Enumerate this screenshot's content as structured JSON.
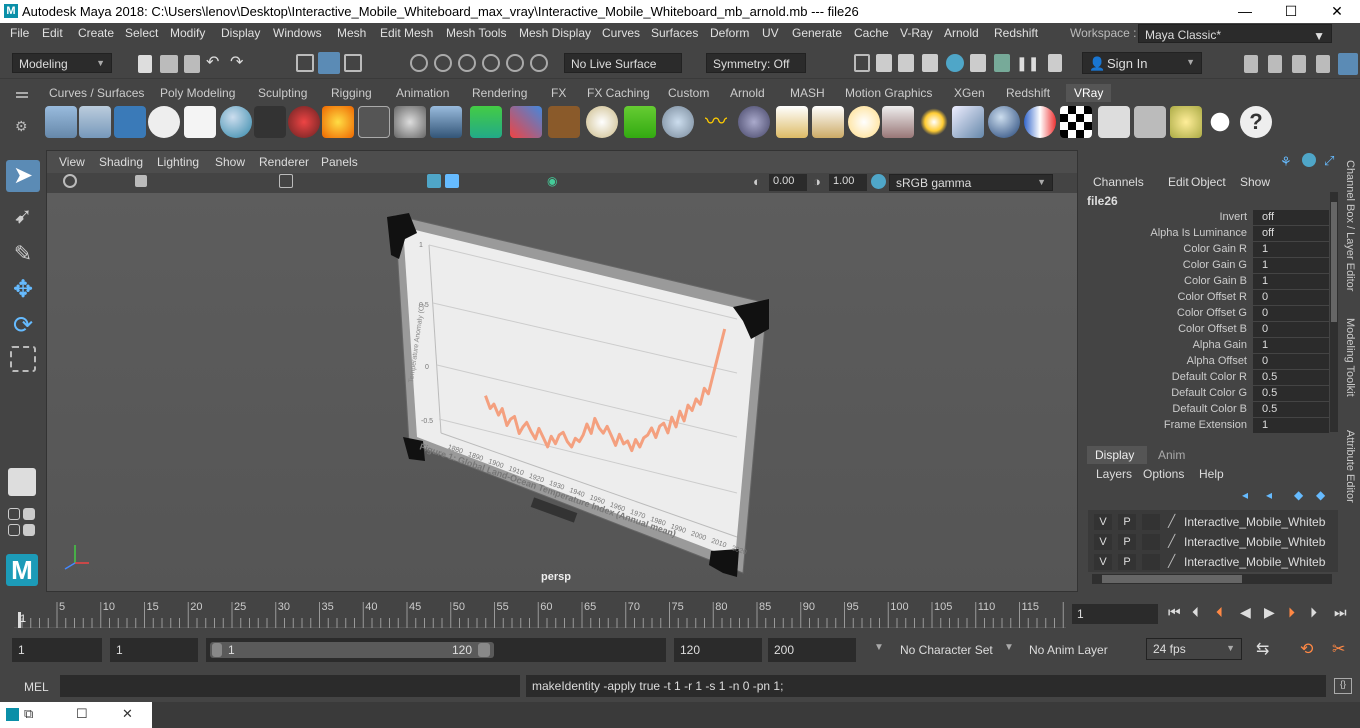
{
  "window": {
    "title": "Autodesk Maya 2018: C:\\Users\\lenov\\Desktop\\Interactive_Mobile_Whiteboard_max_vray\\Interactive_Mobile_Whiteboard_mb_arnold.mb   ---   file26",
    "minimize": "—",
    "maximize": "☐",
    "close": "✕"
  },
  "menu": [
    "File",
    "Edit",
    "Create",
    "Select",
    "Modify",
    "Display",
    "Windows",
    "Mesh",
    "Edit Mesh",
    "Mesh Tools",
    "Mesh Display",
    "Curves",
    "Surfaces",
    "Deform",
    "UV",
    "Generate",
    "Cache",
    "V-Ray",
    "Arnold",
    "Redshift"
  ],
  "workspace": {
    "label": "Workspace :",
    "value": "Maya Classic*"
  },
  "status": {
    "mode": "Modeling",
    "live_surface": "No Live Surface",
    "symmetry": "Symmetry: Off",
    "sign_in": "Sign In"
  },
  "shelf_tabs": [
    "Curves / Surfaces",
    "Poly Modeling",
    "Sculpting",
    "Rigging",
    "Animation",
    "Rendering",
    "FX",
    "FX Caching",
    "Custom",
    "Arnold",
    "MASH",
    "Motion Graphics",
    "XGen",
    "Redshift",
    "VRay"
  ],
  "shelf_active": "VRay",
  "viewport": {
    "menu": [
      "View",
      "Shading",
      "Lighting",
      "Show",
      "Renderer",
      "Panels"
    ],
    "exposure": "0.00",
    "gamma": "1.00",
    "colorspace": "sRGB gamma",
    "camera": "persp"
  },
  "board": {
    "caption": "Figure 1: Global Land-Ocean Temperature Index (Annual mean)",
    "ylabel": "Temperature Anomaly (C)",
    "yticks": [
      "1",
      "0.5",
      "0",
      "-0.5"
    ],
    "xticks": [
      "1880",
      "1890",
      "1900",
      "1910",
      "1920",
      "1930",
      "1940",
      "1950",
      "1960",
      "1970",
      "1980",
      "1990",
      "2000",
      "2010",
      "2020"
    ]
  },
  "channel_box": {
    "menu": [
      "Channels",
      "Edit",
      "Object",
      "Show"
    ],
    "node": "file26",
    "rows": [
      {
        "label": "Invert",
        "value": "off"
      },
      {
        "label": "Alpha Is Luminance",
        "value": "off"
      },
      {
        "label": "Color Gain R",
        "value": "1"
      },
      {
        "label": "Color Gain G",
        "value": "1"
      },
      {
        "label": "Color Gain B",
        "value": "1"
      },
      {
        "label": "Color Offset R",
        "value": "0"
      },
      {
        "label": "Color Offset G",
        "value": "0"
      },
      {
        "label": "Color Offset B",
        "value": "0"
      },
      {
        "label": "Alpha Gain",
        "value": "1"
      },
      {
        "label": "Alpha Offset",
        "value": "0"
      },
      {
        "label": "Default Color R",
        "value": "0.5"
      },
      {
        "label": "Default Color G",
        "value": "0.5"
      },
      {
        "label": "Default Color B",
        "value": "0.5"
      },
      {
        "label": "Frame Extension",
        "value": "1"
      }
    ]
  },
  "layer_editor": {
    "tabs": [
      "Display",
      "Anim"
    ],
    "menu": [
      "Layers",
      "Options",
      "Help"
    ],
    "layers": [
      {
        "v": "V",
        "p": "P",
        "name": "Interactive_Mobile_Whiteboard"
      },
      {
        "v": "V",
        "p": "P",
        "name": "Interactive_Mobile_Whiteboard"
      },
      {
        "v": "V",
        "p": "P",
        "name": "Interactive_Mobile_Whiteboard"
      }
    ]
  },
  "side_tabs": [
    "Channel Box / Layer Editor",
    "Modeling Toolkit",
    "Attribute Editor"
  ],
  "timeline": {
    "ticks": [
      "5",
      "10",
      "15",
      "20",
      "25",
      "30",
      "35",
      "40",
      "45",
      "50",
      "55",
      "60",
      "65",
      "70",
      "75",
      "80",
      "85",
      "90",
      "95",
      "100",
      "105",
      "110",
      "115",
      "12"
    ],
    "first": "1",
    "current_frame": "1"
  },
  "range": {
    "start": "1",
    "playback_start": "1",
    "slider_start": "1",
    "slider_end": "120",
    "playback_end": "120",
    "end": "200",
    "character_set": "No Character Set",
    "anim_layer": "No Anim Layer",
    "fps": "24 fps"
  },
  "command": {
    "lang": "MEL",
    "result": "makeIdentity -apply true -t 1 -r 1 -s 1 -n 0 -pn 1;"
  }
}
